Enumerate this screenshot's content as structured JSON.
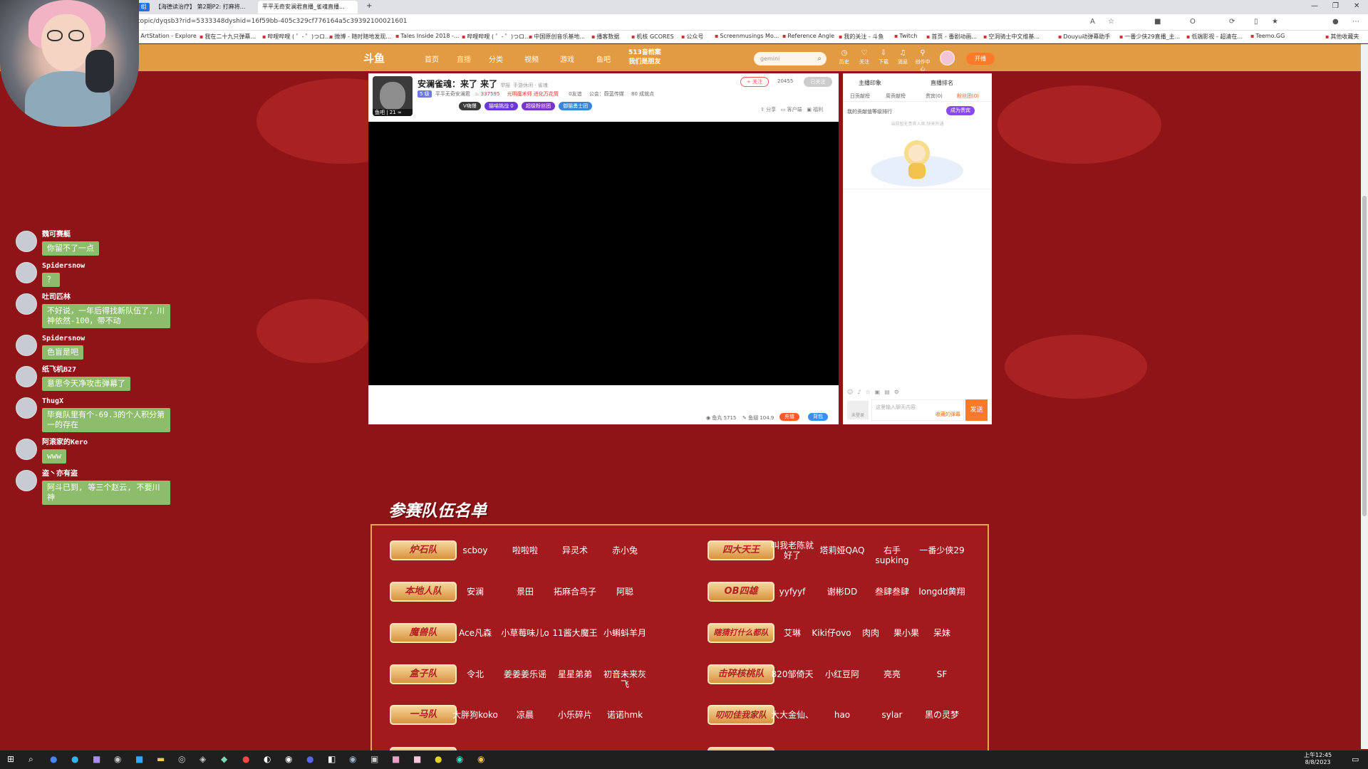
{
  "browser": {
    "tabs": [
      {
        "label": "1 组"
      },
      {
        "label": "【海德读治疗】 第2期P2: 打麻将..."
      },
      {
        "label": "平平无奇安澜君直播_雀魂直播..."
      }
    ],
    "url": "/topic/dyqsb3?rid=5333348dyshid=16f59bb-405c329cf776164a5c39392100021601",
    "bookmarks": [
      "ArtStation - Explore",
      "我在二十九只弹幕...",
      "哔哩哔哩 ( ゜- ゜)つロ...",
      "微博 - 随时随地发现...",
      "Tales Inside 2018 -...",
      "哔哩哔哩 ( ゜- ゜)つロ...",
      "中国原创音乐基地...",
      "播客数据",
      "机核 GCORES",
      "公众号",
      "Screenmusings Mo...",
      "Reference Angle",
      "我的关注 - 斗鱼",
      "Twitch",
      "首页 - 番剧动画...",
      "空洞骑士中文维基...",
      "Douyu动弹幕助手",
      "一番少侠29直播_主...",
      "低端影视 - 超清在...",
      "Teemo.GG"
    ],
    "bookmarks_other": "其他收藏夹"
  },
  "site": {
    "logo": "斗鱼",
    "nav": [
      "首页",
      "直播",
      "分类",
      "视频",
      "游戏",
      "鱼吧"
    ],
    "promo": [
      "513音档案",
      "我们是朋友"
    ],
    "search_placeholder": "gemini",
    "icons": [
      "历史",
      "关注",
      "下载",
      "消息",
      "创作中心"
    ],
    "start_label": "开播"
  },
  "room": {
    "title": "安澜雀魂：来了 来了",
    "report": "举报",
    "category": "手游休闲 · 雀魂",
    "tag": "5 级",
    "streamer": "平平无奇安澜君",
    "hot": "337595",
    "warning": "光明魔术师 进化万花筒",
    "fans_count": "0友谊",
    "notice": "公会：蔚蓝传媒",
    "achievement": "80 成就点",
    "badges": [
      "V嗨爆",
      "猫喵挑战 0",
      "超级粉丝团",
      "御猫勇士团"
    ],
    "follow": "+ 关注",
    "follow_count": "20455",
    "follow_btn": "已关注",
    "tools": [
      "分享",
      "客户端",
      "福利"
    ],
    "footer_stats": [
      "鱼丸 5715",
      "鱼翅 104.9"
    ],
    "footer_btns": [
      "充值",
      "背包"
    ],
    "avatar_level": "鱼吧 | 21 ∞"
  },
  "side_panel": {
    "top": [
      "主播印象",
      "直播排名"
    ],
    "tabs": [
      "日贡献榜",
      "周贡献榜",
      "贵宾(0)",
      "粉丝团(0)"
    ],
    "rank_text": "我的贡献值等级排行",
    "join": "成为贵宾",
    "empty_text": "当前暂无贵宾入席,快来开通",
    "input_placeholder": "这里输入聊天内容",
    "input_hint": "收藏的弹幕",
    "lock": "未登录",
    "send": "发送"
  },
  "chat": [
    {
      "name": "魏可赛艇",
      "text": "你留不了一点"
    },
    {
      "name": "Spidersnow",
      "text": "？"
    },
    {
      "name": "吐司匹林",
      "text": "不好说，一年后得找新队伍了，川神依然-100，带不动"
    },
    {
      "name": "Spidersnow",
      "text": "色盲是吧"
    },
    {
      "name": "纸飞机B27",
      "text": "意思今天净攻击弹幕了"
    },
    {
      "name": "ThugX",
      "text": "毕竟队里有个-69.3的个人积分第一的存在"
    },
    {
      "name": "阿滚家的Kero",
      "text": "www"
    },
    {
      "name": "盗丶亦有盗",
      "text": "阿斗已到, 等三个赵云, 不要川神"
    }
  ],
  "roster": {
    "title": "参赛队伍名单",
    "left_teams": [
      {
        "name": "炉石队",
        "members": [
          "scboy",
          "啦啦啦",
          "异灵术",
          "赤小兔"
        ]
      },
      {
        "name": "本地人队",
        "members": [
          "安澜",
          "景田",
          "拓麻合鸟子",
          "阿聪"
        ]
      },
      {
        "name": "魔兽队",
        "members": [
          "Ace凡森",
          "小草莓味儿o",
          "11酱大魔王",
          "小蝌蚪羊月"
        ]
      },
      {
        "name": "盒子队",
        "members": [
          "令北",
          "姜姜姜乐谣",
          "星星弟弟",
          "初音未来灰飞"
        ]
      },
      {
        "name": "一马队",
        "members": [
          "大胖狗koko",
          "凉晨",
          "小乐碎片",
          "诺诺hmk"
        ]
      }
    ],
    "right_teams": [
      {
        "name": "四大天王",
        "members": [
          "叫我老陈就好了",
          "塔莉娅QAQ",
          "右手supking",
          "一番少侠29"
        ]
      },
      {
        "name": "OB四雄",
        "members": [
          "yyfyyf",
          "谢彬DD",
          "叁肆叁肆",
          "longdd黄翔"
        ]
      },
      {
        "name": "瞎猜打什么都队",
        "members": [
          "艾琳",
          "Kiki仔ovo",
          "肉肉",
          "果小果",
          "呆妹"
        ]
      },
      {
        "name": "击碎核桃队",
        "members": [
          "820邹倚天",
          "小红豆阿",
          "亮亮",
          "SF"
        ]
      },
      {
        "name": "叨叨佳我家队",
        "members": [
          "大大金仙、",
          "hao",
          "sylar",
          "黑の灵梦"
        ]
      }
    ]
  },
  "taskbar": {
    "time": "上午12:45",
    "date": "8/8/2023"
  }
}
